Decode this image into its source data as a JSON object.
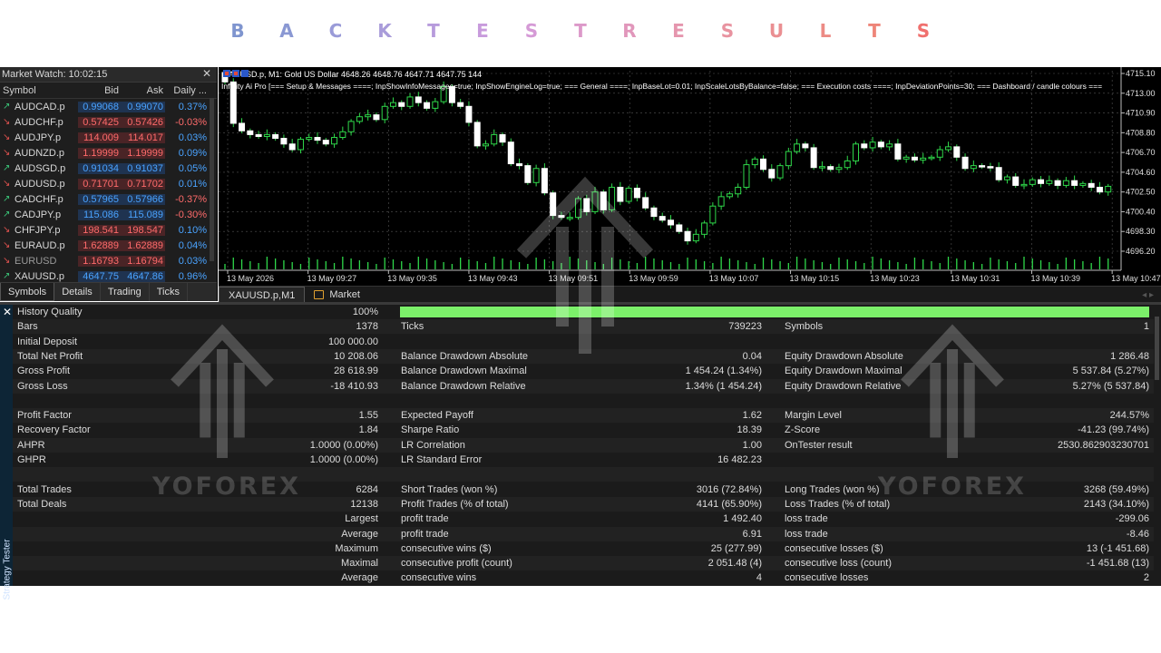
{
  "banner": {
    "letters": [
      {
        "t": "B",
        "c": "#7f95cf"
      },
      {
        "t": "A",
        "c": "#8a98d3"
      },
      {
        "t": "C",
        "c": "#9a9bd8"
      },
      {
        "t": "K",
        "c": "#a99cda"
      },
      {
        "t": "T",
        "c": "#b79bdc"
      },
      {
        "t": "E",
        "c": "#c89bdc"
      },
      {
        "t": "S",
        "c": "#d59ad6"
      },
      {
        "t": "T",
        "c": "#dc99c9"
      },
      {
        "t": "R",
        "c": "#e197bb"
      },
      {
        "t": "E",
        "c": "#e596ae"
      },
      {
        "t": "S",
        "c": "#e893a0"
      },
      {
        "t": "U",
        "c": "#ea8f92"
      },
      {
        "t": "L",
        "c": "#ec8b85"
      },
      {
        "t": "T",
        "c": "#ee8579"
      },
      {
        "t": "S",
        "c": "#f0706e"
      }
    ]
  },
  "market_watch": {
    "title": "Market Watch: 10:02:15",
    "close_glyph": "✕",
    "columns": [
      "Symbol",
      "Bid",
      "Ask",
      "Daily ..."
    ],
    "rows": [
      {
        "sym": "AUDCAD.p",
        "bid": "0.99068",
        "ask": "0.99070",
        "chg": "0.37%",
        "dir": "up"
      },
      {
        "sym": "AUDCHF.p",
        "bid": "0.57425",
        "ask": "0.57426",
        "chg": "-0.03%",
        "dir": "dn"
      },
      {
        "sym": "AUDJPY.p",
        "bid": "114.009",
        "ask": "114.017",
        "chg": "0.03%",
        "dir": "dn"
      },
      {
        "sym": "AUDNZD.p",
        "bid": "1.19999",
        "ask": "1.19999",
        "chg": "0.09%",
        "dir": "dn"
      },
      {
        "sym": "AUDSGD.p",
        "bid": "0.91034",
        "ask": "0.91037",
        "chg": "0.05%",
        "dir": "up"
      },
      {
        "sym": "AUDUSD.p",
        "bid": "0.71701",
        "ask": "0.71702",
        "chg": "0.01%",
        "dir": "dn"
      },
      {
        "sym": "CADCHF.p",
        "bid": "0.57965",
        "ask": "0.57966",
        "chg": "-0.37%",
        "dir": "up"
      },
      {
        "sym": "CADJPY.p",
        "bid": "115.086",
        "ask": "115.089",
        "chg": "-0.30%",
        "dir": "up"
      },
      {
        "sym": "CHFJPY.p",
        "bid": "198.541",
        "ask": "198.547",
        "chg": "0.10%",
        "dir": "dn"
      },
      {
        "sym": "EURAUD.p",
        "bid": "1.62889",
        "ask": "1.62889",
        "chg": "0.04%",
        "dir": "dn"
      },
      {
        "sym": "EURUSD",
        "bid": "1.16793",
        "ask": "1.16794",
        "chg": "0.03%",
        "dir": "dn"
      },
      {
        "sym": "XAUUSD.p",
        "bid": "4647.75",
        "ask": "4647.86",
        "chg": "0.96%",
        "dir": "up"
      }
    ],
    "tabs": [
      "Symbols",
      "Details",
      "Trading",
      "Ticks"
    ]
  },
  "chart": {
    "info": "XAUUSD.p, M1:  Gold US Dollar  4648.26 4648.76 4647.71 4647.75  144",
    "params": "Infinity Ai Pro [=== Setup & Messages ====; InpShowInfoMessages=true; InpShowEngineLog=true; === General ====; InpBaseLot=0.01; InpScaleLotsByBalance=false; === Execution costs ====; InpDeviationPoints=30; === Dashboard / candle colours ===",
    "price_labels": [
      "4715.10",
      "4713.00",
      "4710.90",
      "4708.80",
      "4706.70",
      "4704.60",
      "4702.50",
      "4700.40",
      "4698.30",
      "4696.20"
    ],
    "time_labels": [
      "13 May 2026",
      "13 May 09:27",
      "13 May 09:35",
      "13 May 09:43",
      "13 May 09:51",
      "13 May 09:59",
      "13 May 10:07",
      "13 May 10:15",
      "13 May 10:23",
      "13 May 10:31",
      "13 May 10:39",
      "13 May 10:47"
    ],
    "tabs": [
      "XAUUSD.p,M1",
      "Market"
    ],
    "closes": [
      4714.2,
      4709.8,
      4709.0,
      4708.6,
      4708.4,
      4708.6,
      4708.2,
      4707.6,
      4707.0,
      4708.1,
      4708.3,
      4708.0,
      4707.6,
      4708.3,
      4708.9,
      4710.0,
      4710.5,
      4710.7,
      4710.2,
      4711.6,
      4712.0,
      4711.6,
      4712.6,
      4712.0,
      4711.4,
      4712.1,
      4713.7,
      4712.0,
      4711.6,
      4709.9,
      4707.4,
      4707.6,
      4708.6,
      4707.8,
      4705.5,
      4705.3,
      4703.5,
      4705.0,
      4702.4,
      4700.0,
      4699.8,
      4699.8,
      4701.8,
      4700.4,
      4702.5,
      4700.6,
      4703.0,
      4701.5,
      4702.9,
      4701.9,
      4700.8,
      4699.9,
      4699.5,
      4699.0,
      4698.3,
      4697.3,
      4698.0,
      4699.2,
      4701.0,
      4702.0,
      4702.3,
      4703.0,
      4705.4,
      4706.0,
      4704.9,
      4704.0,
      4705.3,
      4706.8,
      4707.6,
      4707.2,
      4705.1,
      4705.2,
      4704.9,
      4705.1,
      4705.8,
      4707.6,
      4707.2,
      4707.8,
      4707.3,
      4707.6,
      4706.0,
      4706.2,
      4705.9,
      4706.1,
      4706.2,
      4707.0,
      4707.3,
      4706.2,
      4705.0,
      4705.3,
      4705.2,
      4705.1,
      4703.8,
      4704.1,
      4703.2,
      4703.3,
      4703.8,
      4703.4,
      4703.7,
      4703.2,
      4703.7,
      4703.2,
      4703.4,
      4703.0,
      4702.5,
      4703.1
    ]
  },
  "report": {
    "side_label": "Strategy Tester",
    "close_glyph": "✕",
    "rows": [
      [
        "History Quality",
        "100%",
        "",
        "",
        "",
        ""
      ],
      [
        "Bars",
        "1378",
        "Ticks",
        "739223",
        "Symbols",
        "1"
      ],
      [
        "Initial Deposit",
        "100 000.00",
        "",
        "",
        "",
        ""
      ],
      [
        "Total Net Profit",
        "10 208.06",
        "Balance Drawdown Absolute",
        "0.04",
        "Equity Drawdown Absolute",
        "1 286.48"
      ],
      [
        "Gross Profit",
        "28 618.99",
        "Balance Drawdown Maximal",
        "1 454.24 (1.34%)",
        "Equity Drawdown Maximal",
        "5 537.84 (5.27%)"
      ],
      [
        "Gross Loss",
        "-18 410.93",
        "Balance Drawdown Relative",
        "1.34% (1 454.24)",
        "Equity Drawdown Relative",
        "5.27% (5 537.84)"
      ],
      [
        "",
        "",
        "",
        "",
        "",
        ""
      ],
      [
        "Profit Factor",
        "1.55",
        "Expected Payoff",
        "1.62",
        "Margin Level",
        "244.57%"
      ],
      [
        "Recovery Factor",
        "1.84",
        "Sharpe Ratio",
        "18.39",
        "Z-Score",
        "-41.23 (99.74%)"
      ],
      [
        "AHPR",
        "1.0000 (0.00%)",
        "LR Correlation",
        "1.00",
        "OnTester result",
        "2530.862903230701"
      ],
      [
        "GHPR",
        "1.0000 (0.00%)",
        "LR Standard Error",
        "16 482.23",
        "",
        ""
      ],
      [
        "",
        "",
        "",
        "",
        "",
        ""
      ],
      [
        "Total Trades",
        "6284",
        "Short Trades (won %)",
        "3016 (72.84%)",
        "Long Trades (won %)",
        "3268 (59.49%)"
      ],
      [
        "Total Deals",
        "12138",
        "Profit Trades (% of total)",
        "4141 (65.90%)",
        "Loss Trades (% of total)",
        "2143 (34.10%)"
      ],
      [
        "",
        "Largest",
        "profit trade",
        "1 492.40",
        "loss trade",
        "-299.06"
      ],
      [
        "",
        "Average",
        "profit trade",
        "6.91",
        "loss trade",
        "-8.46"
      ],
      [
        "",
        "Maximum",
        "consecutive wins ($)",
        "25 (277.99)",
        "consecutive losses ($)",
        "13 (-1 451.68)"
      ],
      [
        "",
        "Maximal",
        "consecutive profit (count)",
        "2 051.48 (4)",
        "consecutive loss (count)",
        "-1 451.68 (13)"
      ],
      [
        "",
        "Average",
        "consecutive wins",
        "4",
        "consecutive losses",
        "2"
      ]
    ]
  },
  "watermark": {
    "text": "YOFOREX"
  }
}
